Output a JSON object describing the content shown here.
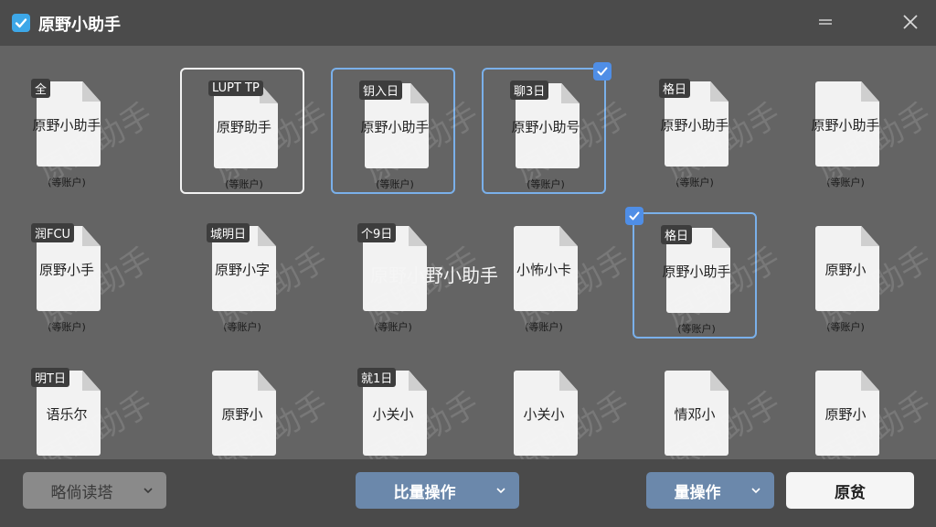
{
  "window": {
    "title": "原野小助手",
    "icon": "checkbox-icon",
    "accent": "#3da7e8"
  },
  "grid": {
    "tiles": [
      {
        "badge": "全",
        "label": "原野小助手",
        "owner": "(等账户)",
        "state": "none"
      },
      {
        "badge": "LUPT TP",
        "label": "原野助手",
        "owner": "(等账户)",
        "state": "white"
      },
      {
        "badge": "钥入日",
        "label": "原野小助手",
        "owner": "(等账户)",
        "state": "blue"
      },
      {
        "badge": "聊3日",
        "label": "原野小助号",
        "owner": "(等账户)",
        "state": "blue-checked"
      },
      {
        "badge": "格日",
        "label": "原野小助手",
        "owner": "(等账户)",
        "state": "none"
      },
      {
        "badge": "",
        "label": "原野小助手",
        "owner": "(等账户)",
        "state": "none"
      },
      {
        "badge": "润FCU",
        "label": "原野小手",
        "owner": "(等账户)",
        "state": "none"
      },
      {
        "badge": "城明日",
        "label": "原野小字",
        "owner": "(等账户)",
        "state": "none"
      },
      {
        "badge": "个9日",
        "label": "",
        "owner": "(等账户)",
        "state": "none"
      },
      {
        "badge": "",
        "label": "小怖小卡",
        "owner": "(等账户)",
        "state": "none"
      },
      {
        "badge": "格日",
        "label": "原野小助手",
        "owner": "(等账户)",
        "state": "blue-checked-left"
      },
      {
        "badge": "",
        "label": "原野小",
        "owner": "(等账户)",
        "state": "none"
      },
      {
        "badge": "明T日",
        "label": "语乐尔",
        "owner": "",
        "state": "none"
      },
      {
        "badge": "",
        "label": "原野小",
        "owner": "",
        "state": "none"
      },
      {
        "badge": "就1日",
        "label": "小关小",
        "owner": "",
        "state": "none"
      },
      {
        "badge": "",
        "label": "小关小",
        "owner": "",
        "state": "none"
      },
      {
        "badge": "",
        "label": "情邓小",
        "owner": "",
        "state": "none"
      },
      {
        "badge": "",
        "label": "原野小",
        "owner": "",
        "state": "none"
      }
    ],
    "center_text": "原野小野小助手",
    "watermark": "原野助手"
  },
  "toolbar": {
    "sort_label": "略倘读塔",
    "batch_label": "比量操作",
    "bulk_label": "量操作",
    "restore_label": "原贫"
  },
  "colors": {
    "selection_blue": "#7ab0ea",
    "check_blue": "#4f8ee6",
    "primary_button": "#6b88ab"
  }
}
